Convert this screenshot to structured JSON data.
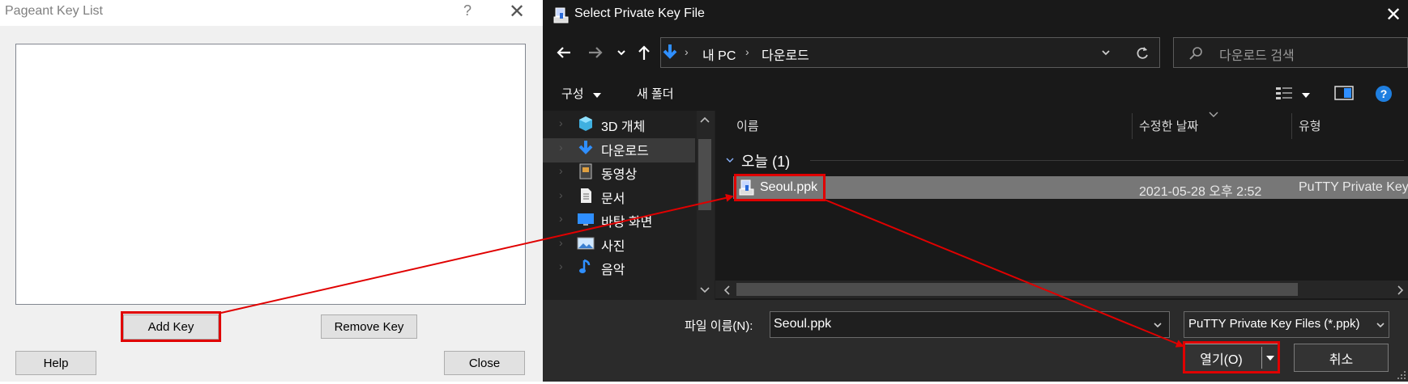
{
  "pageant": {
    "title": "Pageant Key List",
    "help_glyph": "?",
    "close_glyph": "✕",
    "buttons": {
      "add_key": "Add Key",
      "remove_key": "Remove Key",
      "help": "Help",
      "close": "Close"
    }
  },
  "dialog": {
    "title": "Select Private Key File",
    "close_glyph": "✕",
    "breadcrumb": [
      "내 PC",
      "다운로드"
    ],
    "search_placeholder": "다운로드 검색",
    "toolbar": {
      "organize": "구성",
      "new_folder": "새 폴더"
    },
    "nav_items": [
      {
        "label": "3D 개체",
        "icon": "cube-icon"
      },
      {
        "label": "다운로드",
        "icon": "download-icon"
      },
      {
        "label": "동영상",
        "icon": "video-icon"
      },
      {
        "label": "문서",
        "icon": "document-icon"
      },
      {
        "label": "바탕 화면",
        "icon": "desktop-icon"
      },
      {
        "label": "사진",
        "icon": "pictures-icon"
      },
      {
        "label": "음악",
        "icon": "music-icon"
      }
    ],
    "columns": {
      "name": "이름",
      "modified": "수정한 날짜",
      "type": "유형"
    },
    "group": "오늘 (1)",
    "files": [
      {
        "name": "Seoul.ppk",
        "modified": "2021-05-28 오후 2:52",
        "type": "PuTTY Private Key..."
      }
    ],
    "filename_label": "파일 이름(N):",
    "filename_value": "Seoul.ppk",
    "filter_value": "PuTTY Private Key Files (*.ppk)",
    "open_button": "열기(O)",
    "cancel_button": "취소"
  },
  "colors": {
    "annotation_red": "#e00000",
    "dialog_background": "#191919",
    "selected_row": "#777777"
  }
}
